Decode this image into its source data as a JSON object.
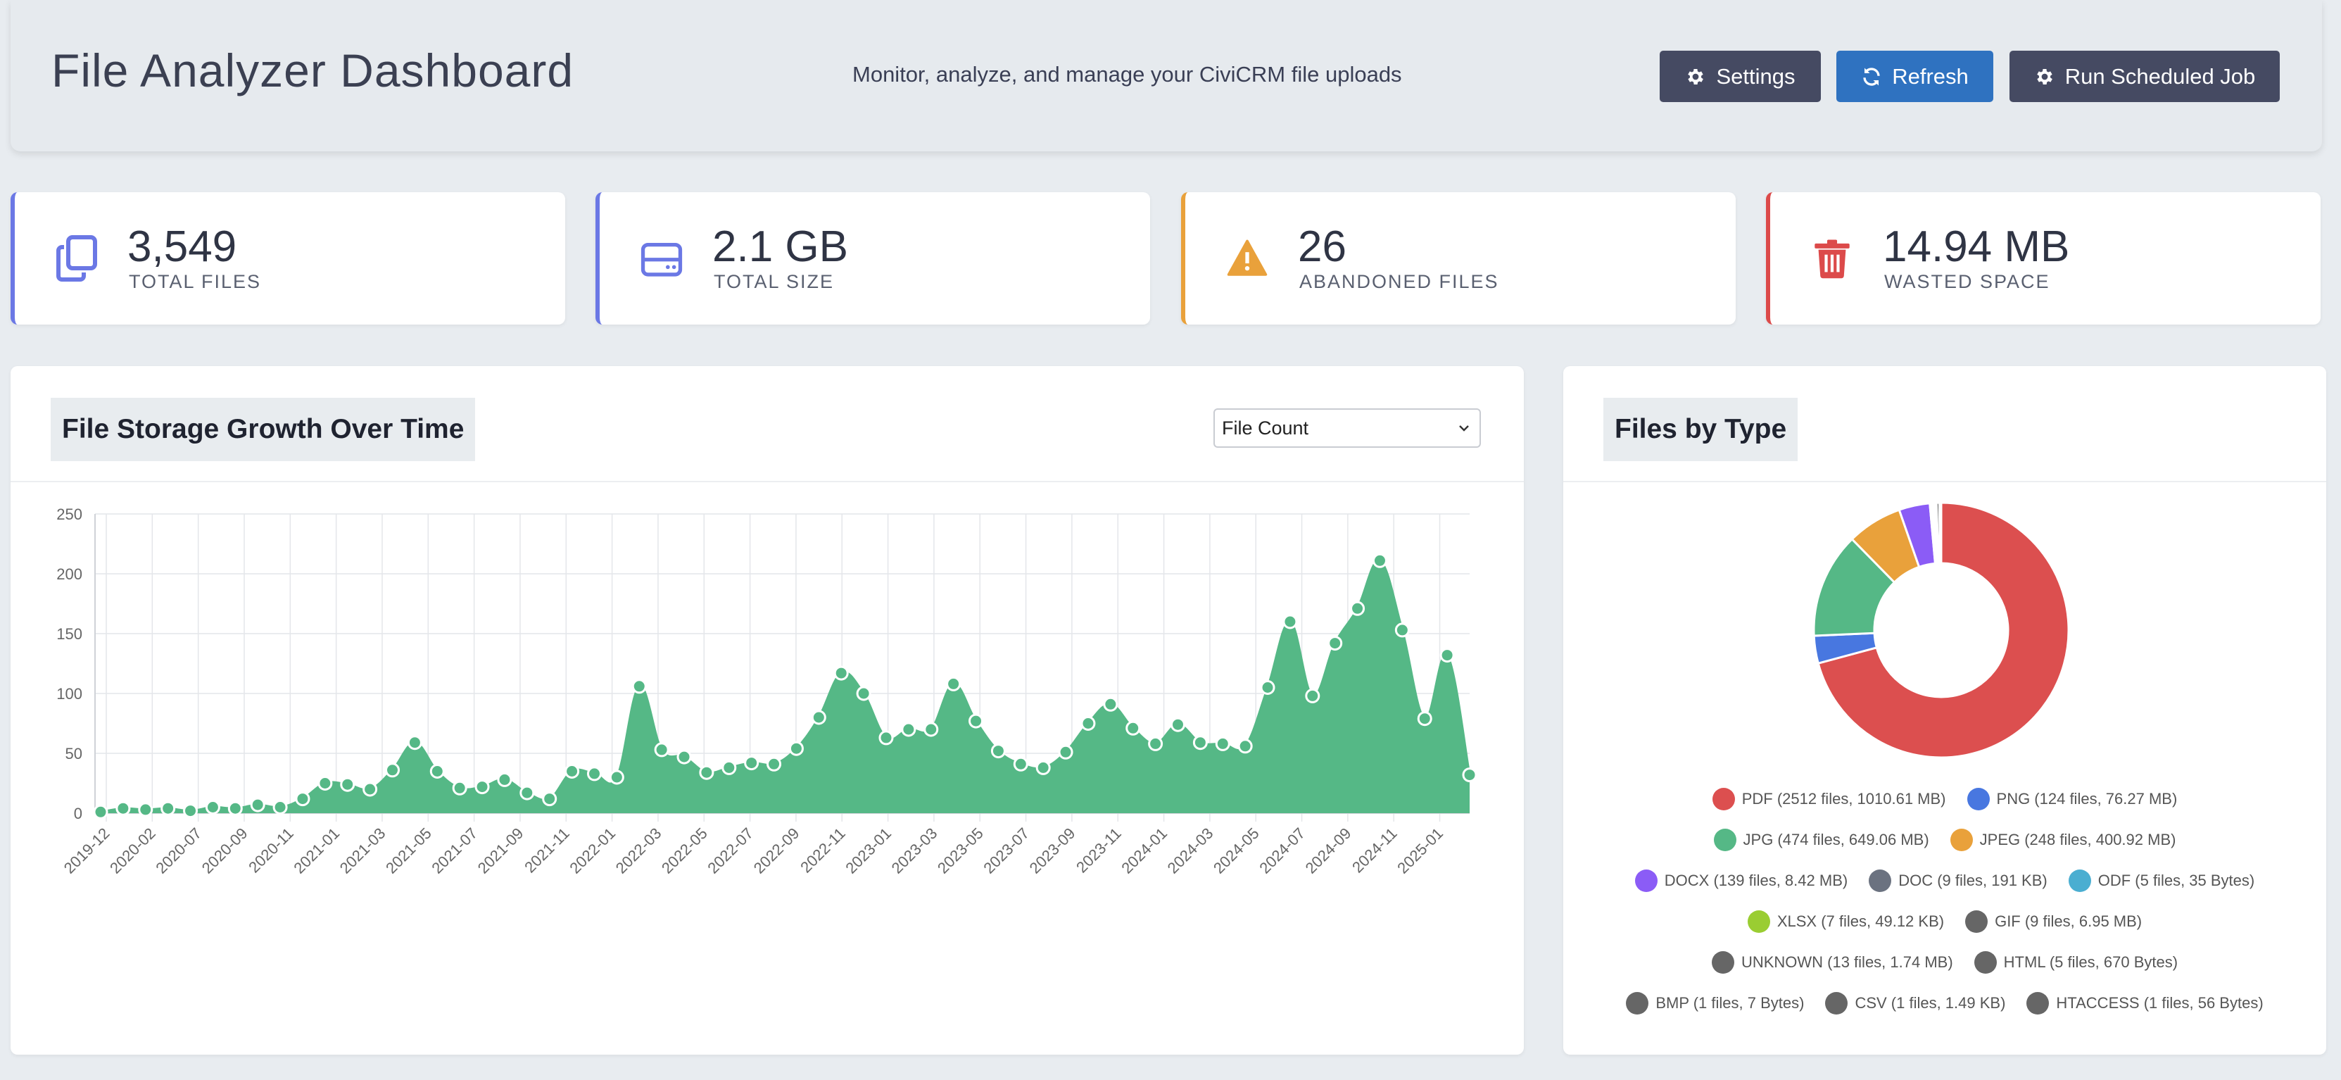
{
  "header": {
    "title": "File Analyzer Dashboard",
    "subtitle": "Monitor, analyze, and manage your CiviCRM file uploads",
    "buttons": {
      "settings": "Settings",
      "refresh": "Refresh",
      "run_job": "Run Scheduled Job"
    }
  },
  "stats": [
    {
      "value": "3,549",
      "label": "TOTAL FILES",
      "icon": "copy-icon",
      "color": "#6b78e5"
    },
    {
      "value": "2.1 GB",
      "label": "TOTAL SIZE",
      "icon": "hard-drive-icon",
      "color": "#6b78e5"
    },
    {
      "value": "26",
      "label": "ABANDONED FILES",
      "icon": "warning-icon",
      "color": "#e9a13b"
    },
    {
      "value": "14.94 MB",
      "label": "WASTED SPACE",
      "icon": "trash-icon",
      "color": "#dc4a4a"
    }
  ],
  "growth_panel": {
    "title": "File Storage Growth Over Time",
    "metric_select": "File Count"
  },
  "type_panel": {
    "title": "Files by Type"
  },
  "chart_data": [
    {
      "type": "area",
      "x": [
        "2019-12",
        "2020-01",
        "2020-02",
        "2020-03",
        "2020-06",
        "2020-07",
        "2020-08",
        "2020-09",
        "2020-10",
        "2020-11",
        "2020-12",
        "2021-01",
        "2021-02",
        "2021-03",
        "2021-04",
        "2021-05",
        "2021-06",
        "2021-07",
        "2021-08",
        "2021-09",
        "2021-10",
        "2021-11",
        "2021-12",
        "2022-01",
        "2022-02",
        "2022-03",
        "2022-04",
        "2022-05",
        "2022-06",
        "2022-07",
        "2022-08",
        "2022-09",
        "2022-10",
        "2022-11",
        "2022-12",
        "2023-01",
        "2023-02",
        "2023-03",
        "2023-04",
        "2023-05",
        "2023-06",
        "2023-07",
        "2023-08",
        "2023-09",
        "2023-10",
        "2023-11",
        "2023-12",
        "2024-01",
        "2024-02",
        "2024-03",
        "2024-04",
        "2024-05",
        "2024-06",
        "2024-07",
        "2024-08",
        "2024-09",
        "2024-10",
        "2024-11",
        "2024-12",
        "2025-01",
        "2025-02"
      ],
      "x_tick_labels": [
        "2019-12",
        "2020-02",
        "2020-07",
        "2020-09",
        "2020-11",
        "2021-01",
        "2021-03",
        "2021-05",
        "2021-07",
        "2021-09",
        "2021-11",
        "2022-01",
        "2022-03",
        "2022-05",
        "2022-07",
        "2022-09",
        "2022-11",
        "2023-01",
        "2023-03",
        "2023-05",
        "2023-07",
        "2023-09",
        "2023-11",
        "2024-01",
        "2024-03",
        "2024-05",
        "2024-07",
        "2024-09",
        "2024-11",
        "2025-01"
      ],
      "series": [
        {
          "values": [
            1,
            4,
            3,
            4,
            2,
            5,
            4,
            7,
            5,
            12,
            25,
            24,
            20,
            36,
            59,
            35,
            21,
            22,
            28,
            17,
            12,
            35,
            33,
            30,
            106,
            53,
            47,
            34,
            38,
            42,
            41,
            54,
            80,
            117,
            100,
            63,
            70,
            70,
            108,
            77,
            52,
            41,
            38,
            51,
            75,
            91,
            71,
            58,
            74,
            59,
            58,
            56,
            105,
            160,
            98,
            142,
            171,
            211,
            153,
            79,
            132,
            32
          ]
        }
      ],
      "ylim": [
        0,
        250
      ],
      "yticks": [
        0,
        50,
        100,
        150,
        200,
        250
      ],
      "grid": true,
      "color": "#55b886"
    },
    {
      "type": "pie",
      "labels": [
        "PDF",
        "PNG",
        "JPG",
        "JPEG",
        "DOCX",
        "DOC",
        "ODF",
        "XLSX",
        "GIF",
        "UNKNOWN",
        "HTML",
        "BMP",
        "CSV",
        "HTACCESS"
      ],
      "values": [
        2512,
        124,
        474,
        248,
        139,
        9,
        5,
        7,
        9,
        13,
        5,
        1,
        1,
        1
      ],
      "legend_text": [
        "PDF (2512 files, 1010.61 MB)",
        "PNG (124 files, 76.27 MB)",
        "JPG (474 files, 649.06 MB)",
        "JPEG (248 files, 400.92 MB)",
        "DOCX (139 files, 8.42 MB)",
        "DOC (9 files, 191 KB)",
        "ODF (5 files, 35 Bytes)",
        "XLSX (7 files, 49.12 KB)",
        "GIF (9 files, 6.95 MB)",
        "UNKNOWN (13 files, 1.74 MB)",
        "HTML (5 files, 670 Bytes)",
        "BMP (1 files, 7 Bytes)",
        "CSV (1 files, 1.49 KB)",
        "HTACCESS (1 files, 56 Bytes)"
      ],
      "colors": [
        "#dc4f4f",
        "#4877e0",
        "#55b886",
        "#e9a13b",
        "#8b5cf6",
        "#6b7280",
        "#4aaed1",
        "#9acd32",
        "#666666",
        "#666666",
        "#666666",
        "#666666",
        "#666666",
        "#666666"
      ],
      "donut": true
    }
  ]
}
